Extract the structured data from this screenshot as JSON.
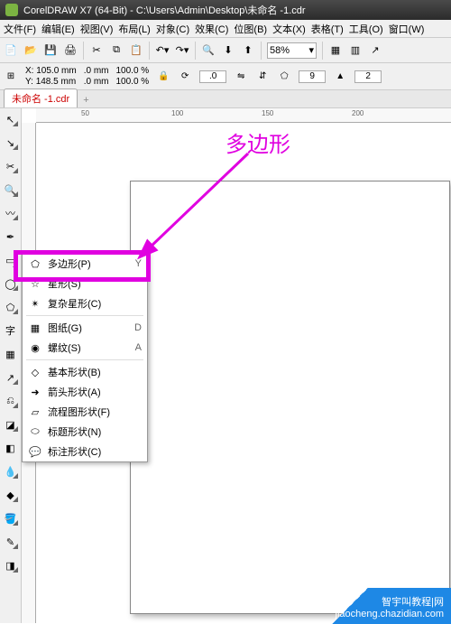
{
  "title": "CorelDRAW X7 (64-Bit) - C:\\Users\\Admin\\Desktop\\未命名 -1.cdr",
  "menus": [
    "文件(F)",
    "编辑(E)",
    "视图(V)",
    "布局(L)",
    "对象(C)",
    "效果(C)",
    "位图(B)",
    "文本(X)",
    "表格(T)",
    "工具(O)",
    "窗口(W)"
  ],
  "zoom": "58%",
  "prop": {
    "x": "105.0 mm",
    "y": "148.5 mm",
    "w": ".0 mm",
    "h": ".0 mm",
    "sx": "100.0",
    "sy": "100.0",
    "rot": ".0",
    "sides": "9",
    "seg": "2"
  },
  "tab": {
    "name": "未命名 -1.cdr"
  },
  "ruler": {
    "m0": "50",
    "m1": "100",
    "m2": "150",
    "m3": "200"
  },
  "flyout": {
    "polygon": {
      "label": "多边形(P)",
      "sc": "Y"
    },
    "star": {
      "label": "星形(S)",
      "sc": ""
    },
    "complex": {
      "label": "复杂星形(C)",
      "sc": ""
    },
    "graph": {
      "label": "图纸(G)",
      "sc": "D"
    },
    "spiral": {
      "label": "螺纹(S)",
      "sc": "A"
    },
    "basic": {
      "label": "基本形状(B)",
      "sc": ""
    },
    "arrow": {
      "label": "箭头形状(A)",
      "sc": ""
    },
    "flow": {
      "label": "流程图形状(F)",
      "sc": ""
    },
    "banner": {
      "label": "标题形状(N)",
      "sc": ""
    },
    "callout": {
      "label": "标注形状(C)",
      "sc": ""
    }
  },
  "anno": {
    "label": "多边形"
  },
  "watermark": {
    "l1": "智宇叫教程|网",
    "l2": "jiaocheng.chazidian.com"
  }
}
